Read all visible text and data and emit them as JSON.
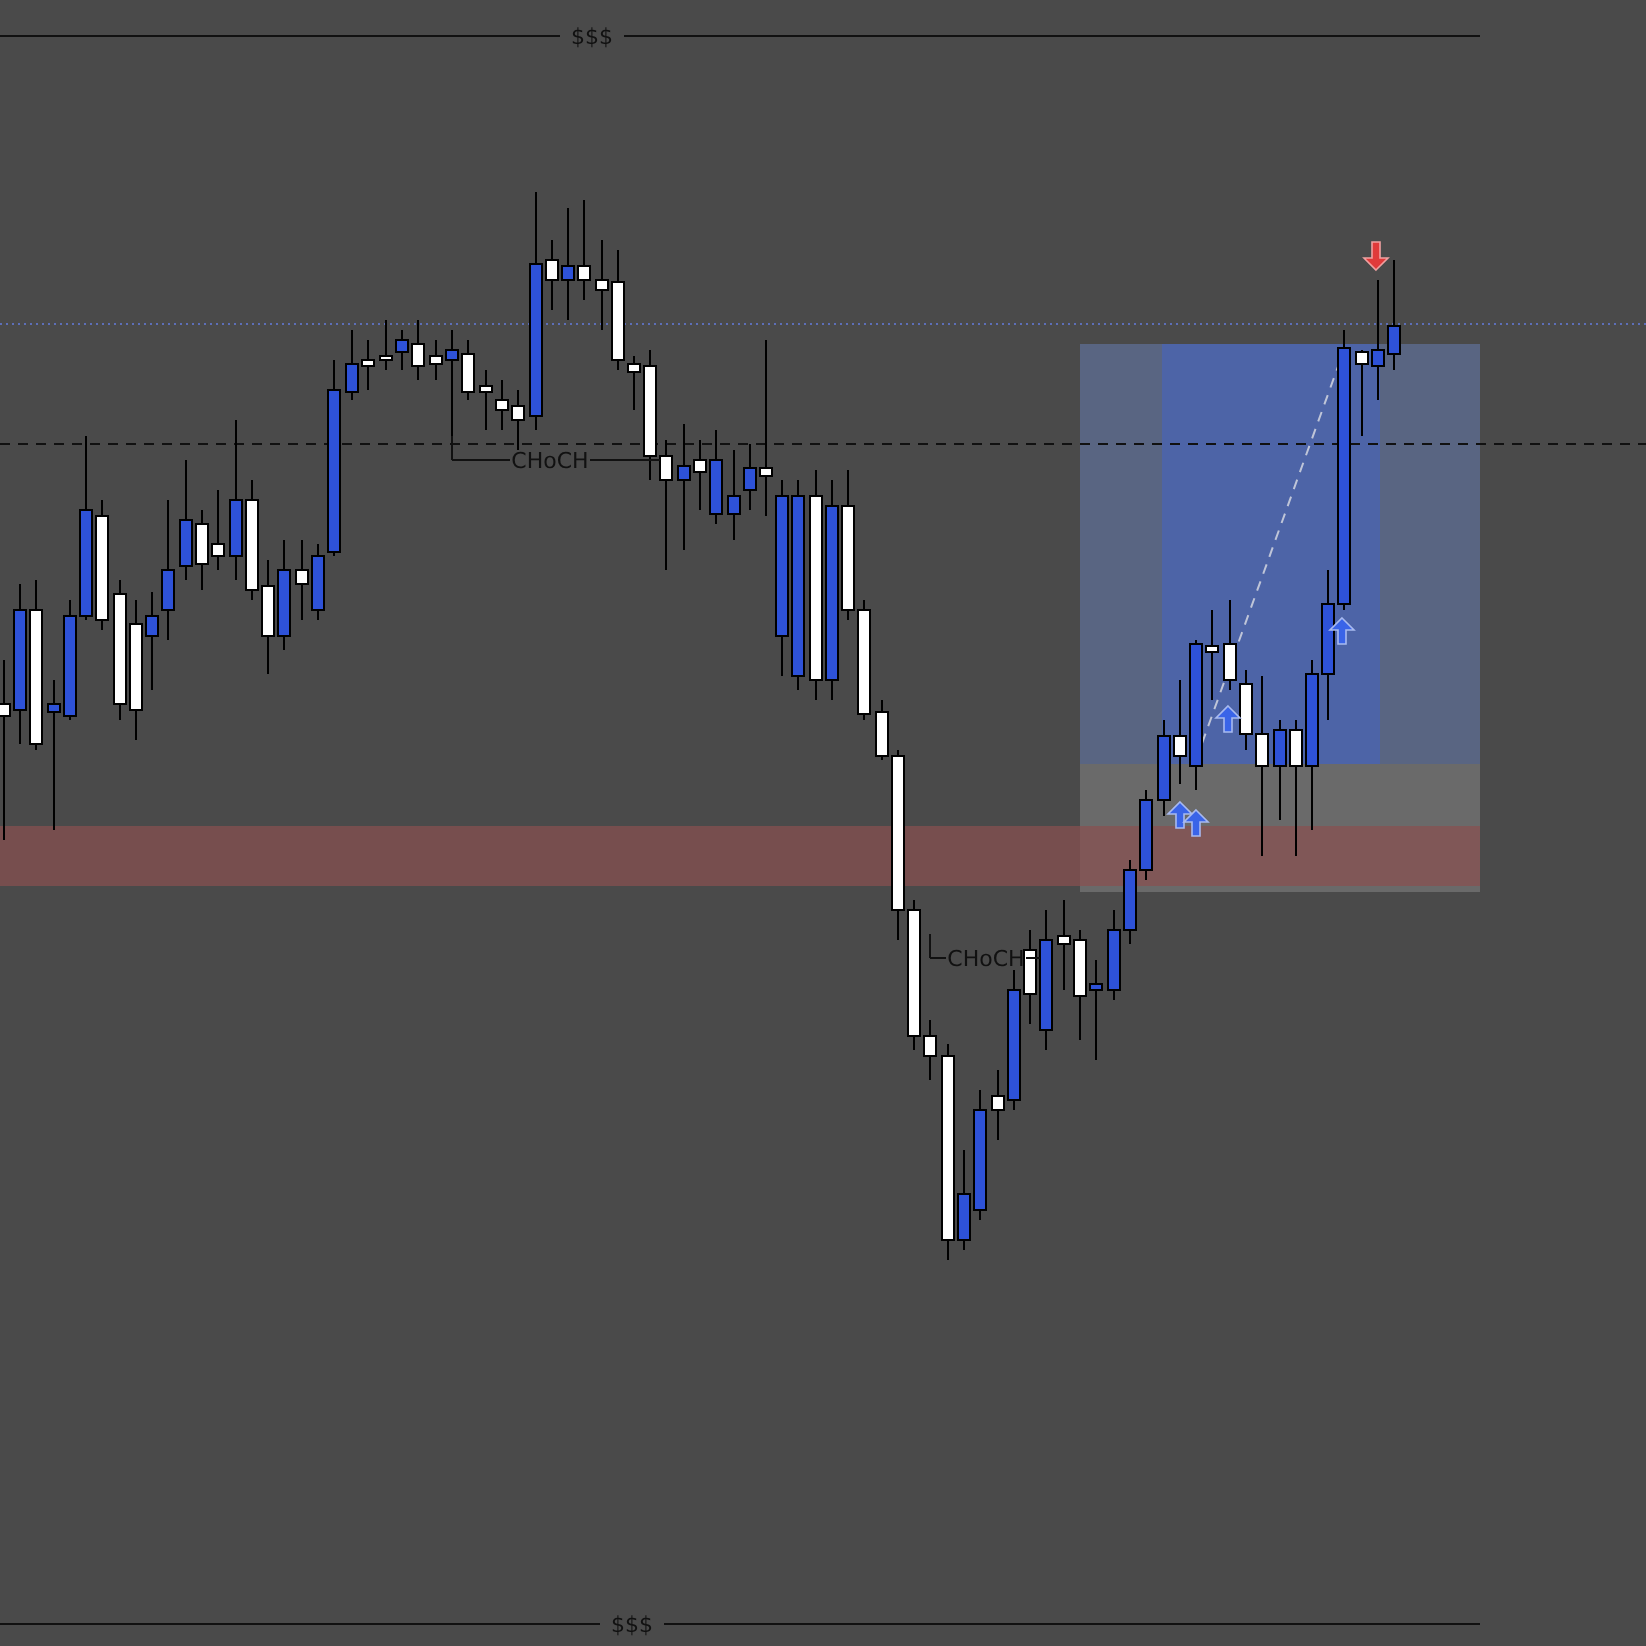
{
  "chart": {
    "top_level_label": "$$$",
    "bottom_level_label": "$$$",
    "structure_labels": [
      "CHoCH",
      "CHoCH"
    ]
  }
}
